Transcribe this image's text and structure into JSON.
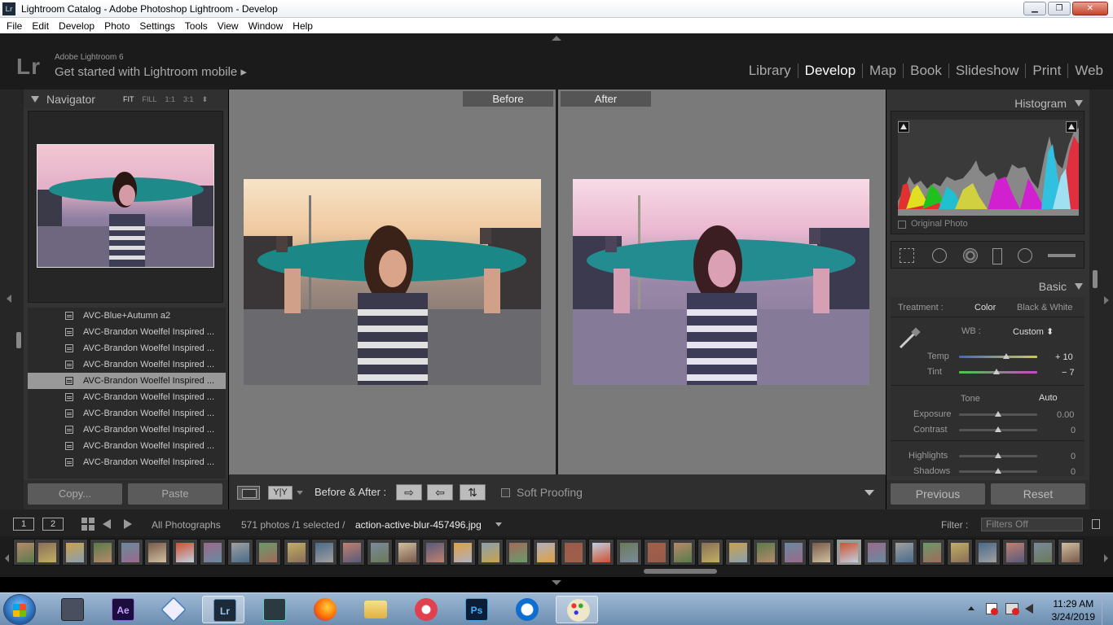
{
  "window": {
    "title": "Lightroom Catalog - Adobe Photoshop Lightroom - Develop",
    "app_icon": "Lr",
    "minimize": "▁",
    "maximize": "❐",
    "close": "✕"
  },
  "menu": [
    "File",
    "Edit",
    "Develop",
    "Photo",
    "Settings",
    "Tools",
    "View",
    "Window",
    "Help"
  ],
  "header": {
    "logo": "Lr",
    "version": "Adobe Lightroom 6",
    "mobile": "Get started with Lightroom mobile ▸",
    "modules": [
      "Library",
      "Develop",
      "Map",
      "Book",
      "Slideshow",
      "Print",
      "Web"
    ],
    "active_module": "Develop"
  },
  "navigator": {
    "title": "Navigator",
    "zoom_options": [
      "FIT",
      "FILL",
      "1:1",
      "3:1"
    ],
    "zoom_active": "FIT",
    "zoom_menu": "⬍"
  },
  "presets": [
    {
      "label": "AVC-Blue+Autumn a2",
      "selected": false
    },
    {
      "label": "AVC-Brandon Woelfel Inspired ...",
      "selected": false
    },
    {
      "label": "AVC-Brandon Woelfel Inspired ...",
      "selected": false
    },
    {
      "label": "AVC-Brandon Woelfel Inspired ...",
      "selected": false
    },
    {
      "label": "AVC-Brandon Woelfel Inspired ...",
      "selected": true
    },
    {
      "label": "AVC-Brandon Woelfel Inspired ...",
      "selected": false
    },
    {
      "label": "AVC-Brandon Woelfel Inspired ...",
      "selected": false
    },
    {
      "label": "AVC-Brandon Woelfel Inspired ...",
      "selected": false
    },
    {
      "label": "AVC-Brandon Woelfel Inspired ...",
      "selected": false
    },
    {
      "label": "AVC-Brandon Woelfel Inspired ...",
      "selected": false
    }
  ],
  "left_buttons": {
    "copy": "Copy...",
    "paste": "Paste"
  },
  "view": {
    "before_label": "Before",
    "after_label": "After"
  },
  "toolbar": {
    "yy": "Y|Y",
    "before_after": "Before & After :",
    "swap_right": "⇨",
    "swap_left": "⇦",
    "swap_both": "⇅",
    "soft_proofing": "Soft Proofing"
  },
  "right": {
    "histogram_title": "Histogram",
    "original_photo": "Original Photo",
    "basic_title": "Basic",
    "treatment_label": "Treatment :",
    "treatment_color": "Color",
    "treatment_bw": "Black & White",
    "wb_label": "WB :",
    "wb_value": "Custom ⬍",
    "temp": {
      "label": "Temp",
      "value": "+ 10",
      "pos": 0.6
    },
    "tint": {
      "label": "Tint",
      "value": "− 7",
      "pos": 0.48
    },
    "tone_label": "Tone",
    "auto": "Auto",
    "exposure": {
      "label": "Exposure",
      "value": "0.00",
      "pos": 0.5
    },
    "contrast": {
      "label": "Contrast",
      "value": "0",
      "pos": 0.5
    },
    "highlights": {
      "label": "Highlights",
      "value": "0",
      "pos": 0.5
    },
    "shadows": {
      "label": "Shadows",
      "value": "0",
      "pos": 0.5
    },
    "previous": "Previous",
    "reset": "Reset"
  },
  "filmstrip_bar": {
    "screen1": "1",
    "screen2": "2",
    "source": "All Photographs",
    "count": "571 photos /1 selected /",
    "filename": "action-active-blur-457496.jpg",
    "filter_label": "Filter :",
    "filter_value": "Filters Off"
  },
  "taskbar": {
    "apps": [
      "film-maker",
      "after-effects",
      "network-app",
      "lightroom",
      "filmora",
      "firefox",
      "file-explorer",
      "camera-app",
      "photoshop",
      "teamviewer",
      "paint"
    ],
    "ae_label": "Ae",
    "lr_label": "Lr",
    "ps_label": "Ps",
    "time": "11:29 AM",
    "date": "3/24/2019"
  },
  "colors": {
    "lr_bg": "#333333",
    "center_bg": "#7a7a7a",
    "accent_teal": "#1f8a8a"
  }
}
